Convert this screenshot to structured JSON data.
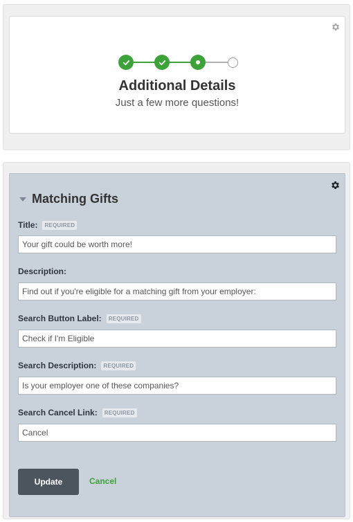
{
  "progress": {
    "steps_total": 4,
    "steps_completed": 2,
    "current_step": 3,
    "accent_color": "#3ea23a"
  },
  "header": {
    "title": "Additional Details",
    "subtitle": "Just a few more questions!"
  },
  "section": {
    "title": "Matching Gifts"
  },
  "required_badge": "REQUIRED",
  "fields": [
    {
      "label": "Title:",
      "required": true,
      "value": "Your gift could be worth more!"
    },
    {
      "label": "Description:",
      "required": false,
      "value": "Find out if you're eligible for a matching gift from your employer:"
    },
    {
      "label": "Search Button Label:",
      "required": true,
      "value": "Check if I'm Eligible"
    },
    {
      "label": "Search Description:",
      "required": true,
      "value": "Is your employer one of these companies?"
    },
    {
      "label": "Search Cancel Link:",
      "required": true,
      "value": "Cancel"
    }
  ],
  "actions": {
    "update_label": "Update",
    "cancel_label": "Cancel"
  },
  "icons": {
    "settings": "gear-icon",
    "collapse": "caret-down-icon",
    "check": "check-icon"
  }
}
